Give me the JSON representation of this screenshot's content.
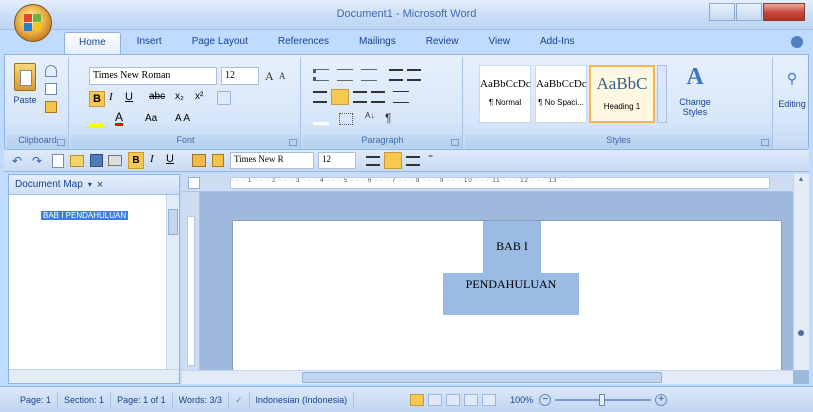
{
  "window": {
    "title": "Document1 - Microsoft Word"
  },
  "tabs": [
    "Home",
    "Insert",
    "Page Layout",
    "References",
    "Mailings",
    "Review",
    "View",
    "Add-Ins"
  ],
  "ribbon": {
    "clipboard": {
      "label": "Clipboard",
      "paste": "Paste"
    },
    "font": {
      "label": "Font",
      "font_name": "Times New Roman",
      "font_size": "12"
    },
    "paragraph": {
      "label": "Paragraph"
    },
    "styles": {
      "label": "Styles",
      "items": [
        {
          "sample": "AaBbCcDc",
          "name": "¶ Normal"
        },
        {
          "sample": "AaBbCcDc",
          "name": "¶ No Spaci..."
        },
        {
          "sample": "AaBbC",
          "name": "Heading 1"
        }
      ],
      "change_styles": "Change Styles",
      "editing": "Editing"
    }
  },
  "qat": {
    "font_name": "Times New R",
    "font_size": "12"
  },
  "document_map": {
    "title": "Document Map",
    "items": [
      "BAB I PENDAHULUAN"
    ]
  },
  "ruler": {
    "ticks": "· · · 1 · · · 2 · · · 3 · · · 4 · · · 5 · · · 6 · · · 7 · · · 8 · · · 9 · · · 10 · · · 11 · · · 12 · · · 13 · · ·"
  },
  "document": {
    "lines": [
      "BAB I",
      "PENDAHULUAN"
    ]
  },
  "status": {
    "page": "Page: 1",
    "section": "Section: 1",
    "page_of": "Page: 1 of 1",
    "words": "Words: 3/3",
    "language": "Indonesian (Indonesia)",
    "zoom": "100%"
  },
  "colors": {
    "ribbon_blue": "#bfdbff",
    "selection": "#99bbe4",
    "accent": "#15428b"
  }
}
